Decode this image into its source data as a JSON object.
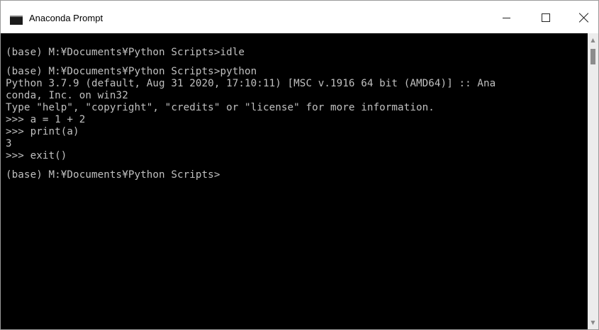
{
  "window": {
    "title": "Anaconda Prompt",
    "controls": {
      "minimize": "minimize",
      "maximize": "maximize",
      "close": "close"
    }
  },
  "console": {
    "lines": [
      "(base) M:¥Documents¥Python Scripts>idle",
      "",
      "(base) M:¥Documents¥Python Scripts>python",
      "Python 3.7.9 (default, Aug 31 2020, 17:10:11) [MSC v.1916 64 bit (AMD64)] :: Ana",
      "conda, Inc. on win32",
      "Type \"help\", \"copyright\", \"credits\" or \"license\" for more information.",
      ">>> a = 1 + 2",
      ">>> print(a)",
      "3",
      ">>> exit()",
      "",
      "(base) M:¥Documents¥Python Scripts>"
    ]
  },
  "scrollbar": {
    "up_arrow": "▲",
    "down_arrow": "▼"
  },
  "colors": {
    "console_background": "#000000",
    "console_text": "#c0c0c0",
    "titlebar_background": "#ffffff"
  }
}
